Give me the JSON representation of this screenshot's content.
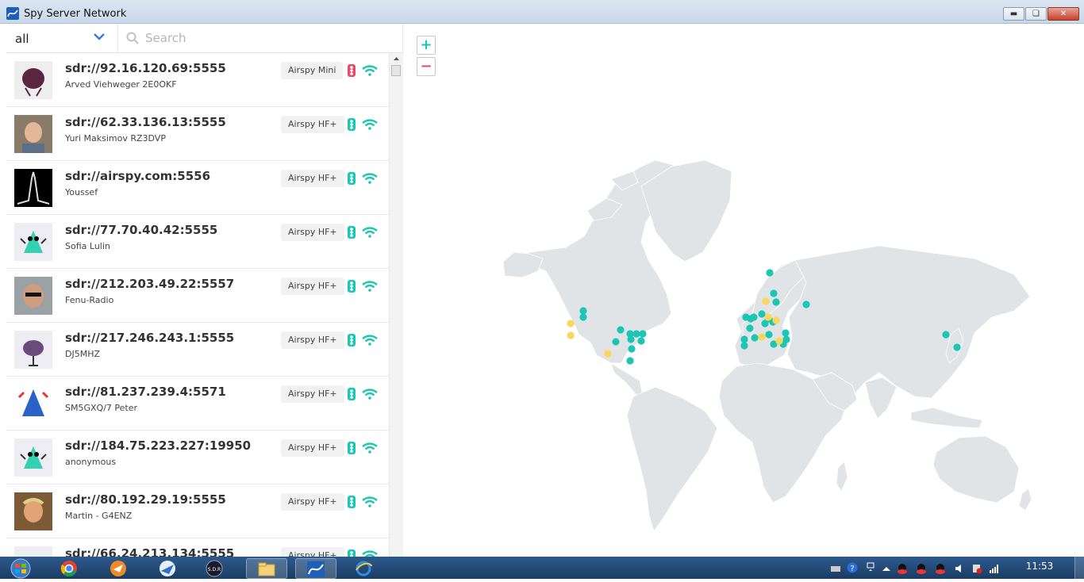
{
  "window": {
    "title": "Spy Server Network"
  },
  "filter": {
    "selected": "all",
    "search_placeholder": "Search"
  },
  "servers": [
    {
      "host": "sdr://92.16.120.69:5555",
      "owner": "Arved Viehweger 2E0OKF",
      "device": "Airspy Mini",
      "status_color": "#e84a6a"
    },
    {
      "host": "sdr://62.33.136.13:5555",
      "owner": "Yuri Maksimov RZ3DVP",
      "device": "Airspy HF+",
      "status_color": "#1cc6b2"
    },
    {
      "host": "sdr://airspy.com:5556",
      "owner": "Youssef",
      "device": "Airspy HF+",
      "status_color": "#1cc6b2"
    },
    {
      "host": "sdr://77.70.40.42:5555",
      "owner": "Sofia Lulin",
      "device": "Airspy HF+",
      "status_color": "#1cc6b2"
    },
    {
      "host": "sdr://212.203.49.22:5557",
      "owner": "Fenu-Radio",
      "device": "Airspy HF+",
      "status_color": "#1cc6b2"
    },
    {
      "host": "sdr://217.246.243.1:5555",
      "owner": "DJ5MHZ",
      "device": "Airspy HF+",
      "status_color": "#1cc6b2"
    },
    {
      "host": "sdr://81.237.239.4:5571",
      "owner": "SM5GXQ/7 Peter",
      "device": "Airspy HF+",
      "status_color": "#1cc6b2"
    },
    {
      "host": "sdr://184.75.223.227:19950",
      "owner": "anonymous",
      "device": "Airspy HF+",
      "status_color": "#1cc6b2"
    },
    {
      "host": "sdr://80.192.29.19:5555",
      "owner": "Martin - G4ENZ",
      "device": "Airspy HF+",
      "status_color": "#1cc6b2"
    },
    {
      "host": "sdr://66.24.213.134:5555",
      "owner": "",
      "device": "Airspy HF+",
      "status_color": "#1cc6b2"
    }
  ],
  "map": {
    "zoom_in": "+",
    "zoom_out": "−",
    "marker_colors": {
      "online": "#1cc6b2",
      "busy": "#f9d65c"
    }
  },
  "taskbar": {
    "time": "11:53"
  },
  "colors": {
    "accent": "#1cc6b2",
    "alert": "#e84a6a",
    "land": "#e1e4e7"
  }
}
